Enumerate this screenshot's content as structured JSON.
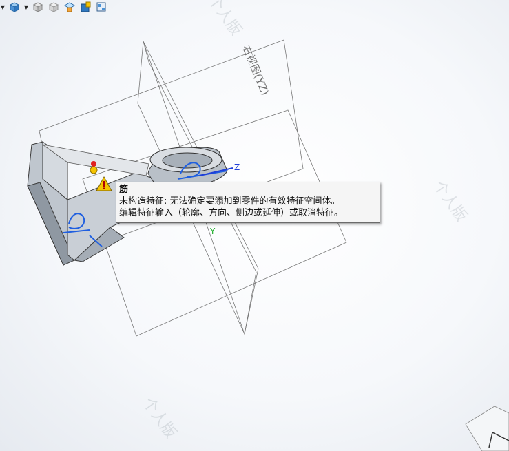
{
  "toolbar": {
    "icons": [
      "view-orientation-icon",
      "display-style-icon",
      "hidden-lines-icon",
      "shaded-icon",
      "appearance-icon",
      "scene-icon",
      "view-settings-icon"
    ]
  },
  "viewport": {
    "plane_label": "右视图(YZ)",
    "axis_z": "Z",
    "axis_y": "Y",
    "watermark": "个人版"
  },
  "tooltip": {
    "title": "筋",
    "line1": "未构造特征: 无法确定要添加到零件的有效特征空间体。",
    "line2": "编辑特征输入（轮廓、方向、侧边或延伸）或取消特征。"
  },
  "colors": {
    "axis_z": "#1f3fd8",
    "axis_y": "#1fae2b",
    "warning": "#f5c400",
    "sketch": "#1f5fe0"
  }
}
